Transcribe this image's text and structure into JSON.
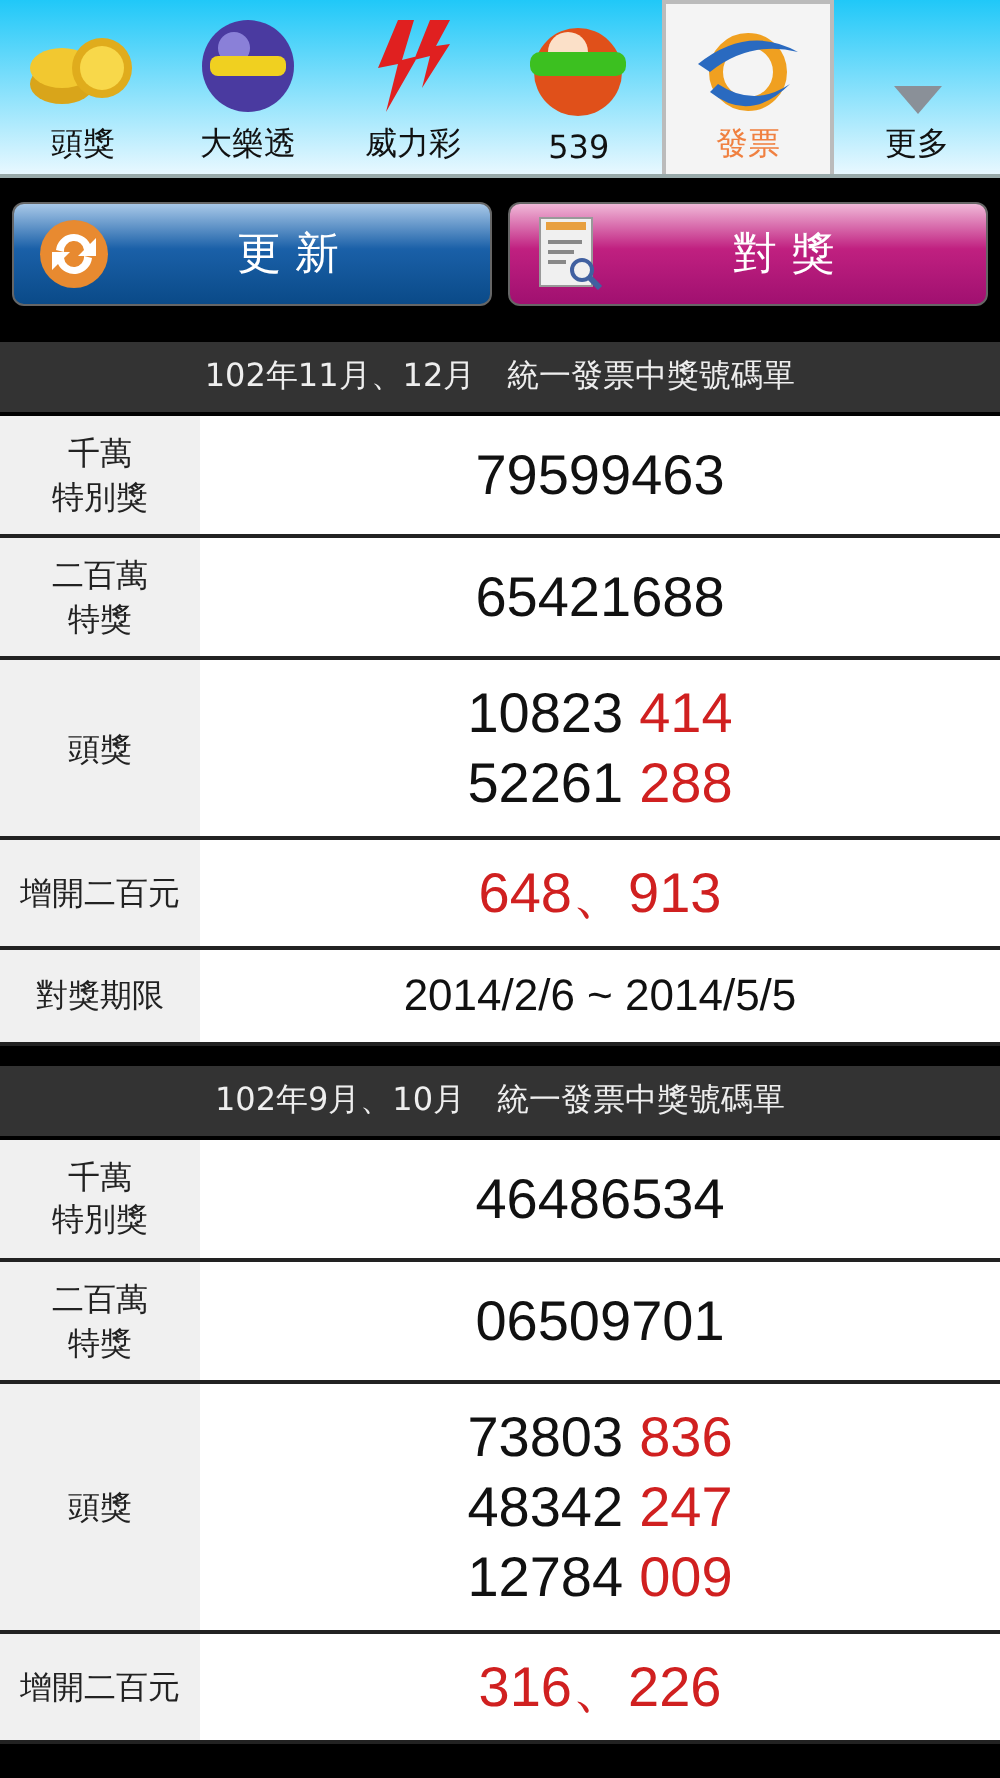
{
  "tabs": [
    {
      "label": "頭獎",
      "selected": false
    },
    {
      "label": "大樂透",
      "selected": false
    },
    {
      "label": "威力彩",
      "selected": false
    },
    {
      "label": "539",
      "selected": false
    },
    {
      "label": "發票",
      "selected": true
    },
    {
      "label": "更多",
      "selected": false
    }
  ],
  "actions": [
    {
      "label": "更 新",
      "kind": "refresh"
    },
    {
      "label": "對 獎",
      "kind": "check"
    }
  ],
  "sections": [
    {
      "title": "102年11月、12月　統一發票中獎號碼單",
      "rows": [
        {
          "label": [
            "千萬",
            "特別獎"
          ],
          "lines": [
            [
              {
                "text": "79599463",
                "highlight": false
              }
            ]
          ]
        },
        {
          "label": [
            "二百萬",
            "特獎"
          ],
          "lines": [
            [
              {
                "text": "65421688",
                "highlight": false
              }
            ]
          ]
        },
        {
          "label": [
            "頭獎"
          ],
          "lines": [
            [
              {
                "text": "10823",
                "highlight": false
              },
              {
                "text": "414",
                "highlight": true
              }
            ],
            [
              {
                "text": "52261",
                "highlight": false
              },
              {
                "text": "288",
                "highlight": true
              }
            ]
          ]
        },
        {
          "label": [
            "增開二百元"
          ],
          "lines": [
            [
              {
                "text": "648、913",
                "highlight": true
              }
            ]
          ]
        },
        {
          "label": [
            "對獎期限"
          ],
          "lines": [
            [
              {
                "text": "2014/2/6 ~ 2014/5/5",
                "highlight": false
              }
            ]
          ],
          "kind": "period"
        }
      ]
    },
    {
      "title": "102年9月、10月　統一發票中獎號碼單",
      "rows": [
        {
          "label": [
            "千萬",
            "特別獎"
          ],
          "lines": [
            [
              {
                "text": "46486534",
                "highlight": false
              }
            ]
          ]
        },
        {
          "label": [
            "二百萬",
            "特獎"
          ],
          "lines": [
            [
              {
                "text": "06509701",
                "highlight": false
              }
            ]
          ]
        },
        {
          "label": [
            "頭獎"
          ],
          "lines": [
            [
              {
                "text": "73803",
                "highlight": false
              },
              {
                "text": "836",
                "highlight": true
              }
            ],
            [
              {
                "text": "48342",
                "highlight": false
              },
              {
                "text": "247",
                "highlight": true
              }
            ],
            [
              {
                "text": "12784",
                "highlight": false
              },
              {
                "text": "009",
                "highlight": true
              }
            ]
          ]
        },
        {
          "label": [
            "增開二百元"
          ],
          "lines": [
            [
              {
                "text": "316、226",
                "highlight": true
              }
            ]
          ]
        }
      ]
    }
  ]
}
